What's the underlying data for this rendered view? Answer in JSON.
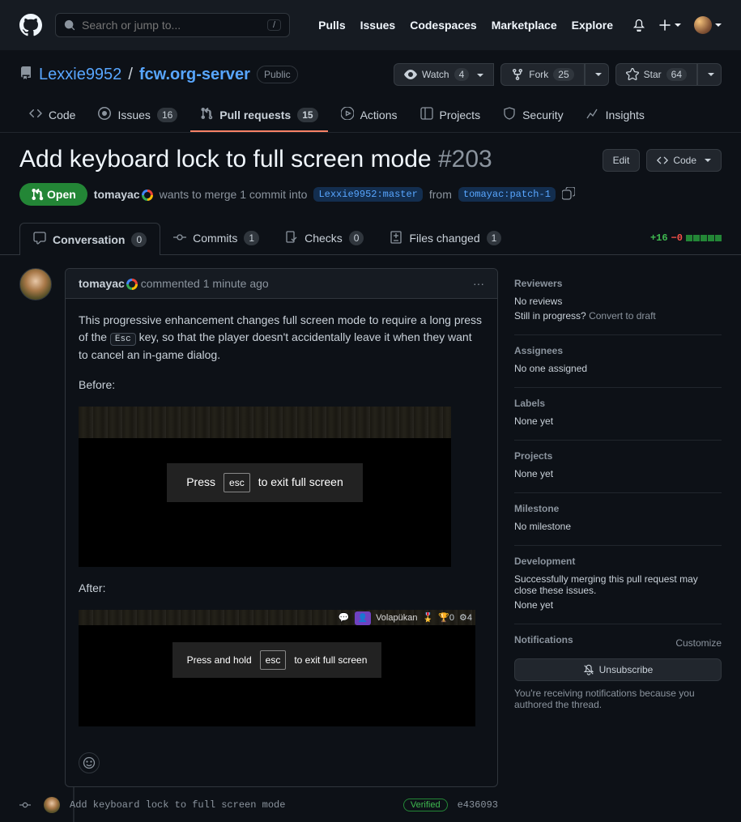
{
  "nav": {
    "search_placeholder": "Search or jump to...",
    "links": {
      "pulls": "Pulls",
      "issues": "Issues",
      "codespaces": "Codespaces",
      "marketplace": "Marketplace",
      "explore": "Explore"
    }
  },
  "repo": {
    "owner": "Lexxie9952",
    "name": "fcw.org-server",
    "visibility": "Public",
    "actions": {
      "watch": "Watch",
      "watch_count": "4",
      "fork": "Fork",
      "fork_count": "25",
      "star": "Star",
      "star_count": "64"
    },
    "tabs": {
      "code": "Code",
      "issues": "Issues",
      "issues_count": "16",
      "pulls": "Pull requests",
      "pulls_count": "15",
      "actions": "Actions",
      "projects": "Projects",
      "security": "Security",
      "insights": "Insights"
    }
  },
  "pr": {
    "title": "Add keyboard lock to full screen mode",
    "number": "#203",
    "edit": "Edit",
    "code_btn": "Code",
    "state": "Open",
    "author": "tomayac",
    "meta_middle": "wants to merge 1 commit into",
    "base_branch": "Lexxie9952:master",
    "meta_from": "from",
    "head_branch": "tomayac:patch-1",
    "inner_tabs": {
      "conversation": "Conversation",
      "conversation_count": "0",
      "commits": "Commits",
      "commits_count": "1",
      "checks": "Checks",
      "checks_count": "0",
      "files": "Files changed",
      "files_count": "1"
    },
    "diffstat": {
      "add": "+16",
      "del": "−0"
    }
  },
  "comment": {
    "author": "tomayac",
    "time_prefix": "commented",
    "time": "1 minute ago",
    "body_p1a": "This progressive enhancement changes full screen mode to require a long press of the ",
    "body_esc": "Esc",
    "body_p1b": " key, so that the player doesn't accidentally leave it when they want to cancel an in-game dialog.",
    "before_label": "Before:",
    "after_label": "After:",
    "ss1": {
      "press": "Press",
      "esc": "esc",
      "rest": "to exit full screen"
    },
    "ss2": {
      "press": "Press and hold",
      "esc": "esc",
      "rest": "to exit full screen",
      "nation": "Volapükan",
      "gold": "0",
      "other": "4"
    }
  },
  "commit": {
    "message": "Add keyboard lock to full screen mode",
    "verified": "Verified",
    "sha": "e436093"
  },
  "sidebar": {
    "reviewers": {
      "title": "Reviewers",
      "v1": "No reviews",
      "progress": "Still in progress?",
      "convert": "Convert to draft"
    },
    "assignees": {
      "title": "Assignees",
      "value": "No one assigned"
    },
    "labels": {
      "title": "Labels",
      "value": "None yet"
    },
    "projects": {
      "title": "Projects",
      "value": "None yet"
    },
    "milestone": {
      "title": "Milestone",
      "value": "No milestone"
    },
    "development": {
      "title": "Development",
      "value": "Successfully merging this pull request may close these issues.",
      "none": "None yet"
    },
    "notifications": {
      "title": "Notifications",
      "customize": "Customize",
      "unsub": "Unsubscribe",
      "reason": "You're receiving notifications because you authored the thread."
    }
  }
}
